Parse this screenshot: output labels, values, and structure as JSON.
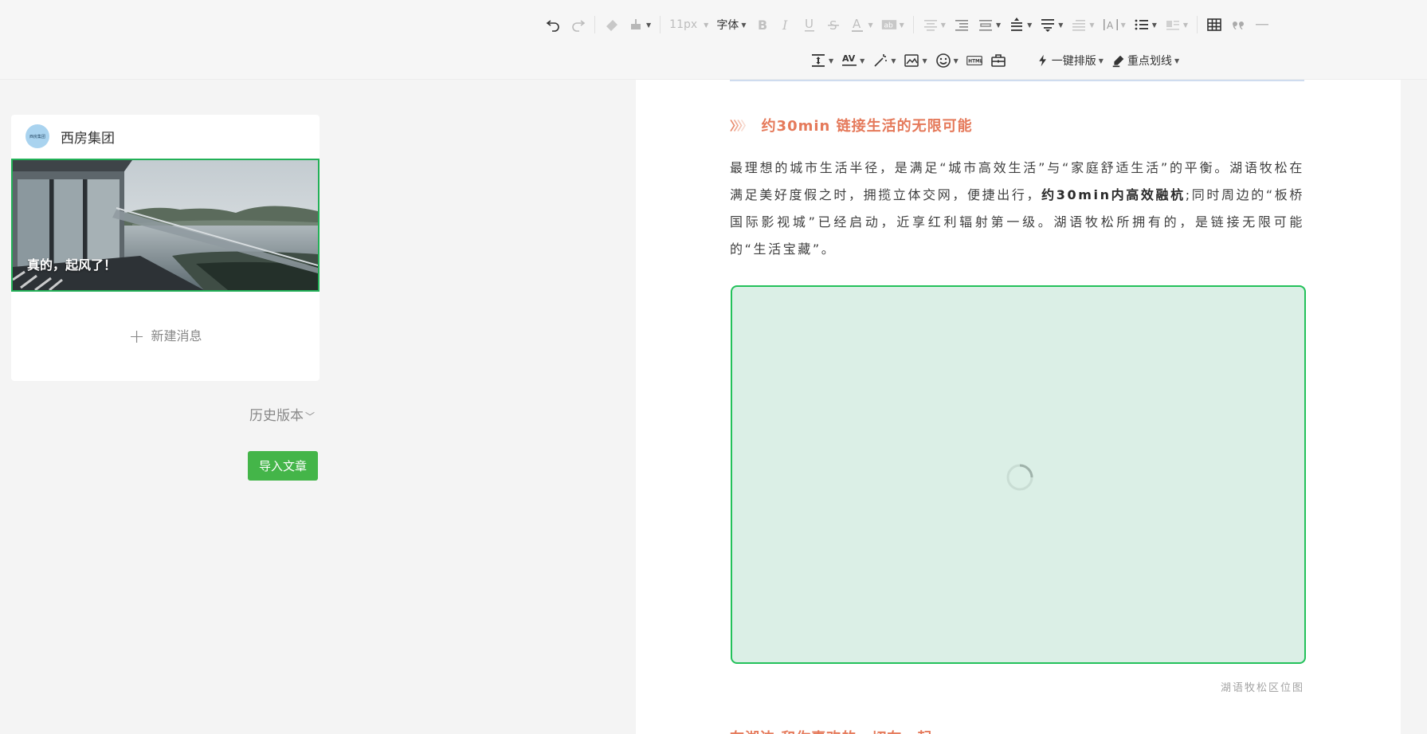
{
  "toolbar": {
    "font_size": "11px",
    "font_family": "字体",
    "one_click_layout": "一键排版",
    "highlight_underline": "重点划线"
  },
  "sidebar": {
    "account_name": "西房集团",
    "avatar_text": "西房集团",
    "cover_title": "真的，起风了！",
    "new_message": "新建消息",
    "history_version": "历史版本",
    "import_article": "导入文章"
  },
  "article": {
    "section_title": "约30min 链接生活的无限可能",
    "paragraph_part1": "最理想的城市生活半径，是满足“城市高效生活”与“家庭舒适生活”的平衡。湖语牧松在满足美好度假之时，拥揽立体交网，便捷出行，",
    "paragraph_bold": "约30min内高效融杭",
    "paragraph_part2": ";同时周边的“板桥国际影视城”已经启动，近享红利辐射第一级。湖语牧松所拥有的，是链接无限可能的“生活宝藏”。",
    "image_caption": "湖语牧松区位图",
    "next_section_title": "在湖边 和你喜欢的一切在一起"
  },
  "colors": {
    "accent_green": "#44b549",
    "selection_green": "#22b057",
    "title_orange": "#e57a5b",
    "map_placeholder": "#dbefe6"
  }
}
